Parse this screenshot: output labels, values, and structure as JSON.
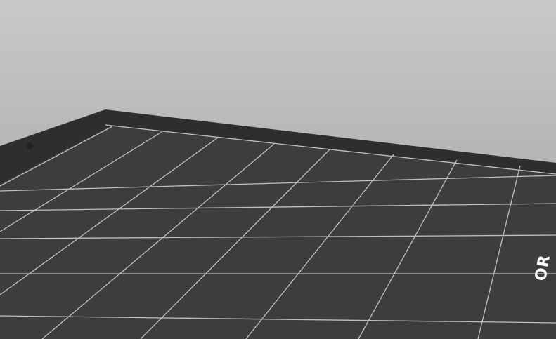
{
  "viewport": {
    "title": "3D view"
  },
  "bed": {
    "label": "OR"
  },
  "colors": {
    "background": "#b5b5b5",
    "bed": "#3b3b3b",
    "model": "#e07306",
    "model_shadow": "#a65200",
    "upright": "#8c4600"
  }
}
